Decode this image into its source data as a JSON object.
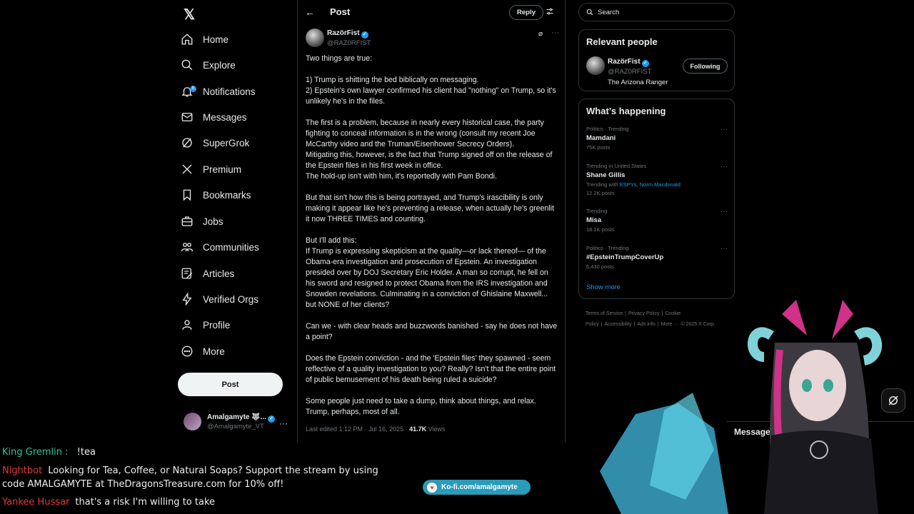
{
  "nav": {
    "items": [
      {
        "label": "Home",
        "icon": "home-icon"
      },
      {
        "label": "Explore",
        "icon": "search-icon"
      },
      {
        "label": "Notifications",
        "icon": "bell-icon",
        "badge": "6"
      },
      {
        "label": "Messages",
        "icon": "mail-icon"
      },
      {
        "label": "SuperGrok",
        "icon": "grok-icon"
      },
      {
        "label": "Premium",
        "icon": "x-logo-icon"
      },
      {
        "label": "Bookmarks",
        "icon": "bookmark-icon"
      },
      {
        "label": "Jobs",
        "icon": "briefcase-icon"
      },
      {
        "label": "Communities",
        "icon": "people-icon"
      },
      {
        "label": "Articles",
        "icon": "article-icon"
      },
      {
        "label": "Verified Orgs",
        "icon": "lightning-icon"
      },
      {
        "label": "Profile",
        "icon": "person-icon"
      },
      {
        "label": "More",
        "icon": "more-circle-icon"
      }
    ],
    "post_button": "Post",
    "account": {
      "name": "Amalgamyte 🐺...",
      "handle": "@Amalgamyte_VT"
    }
  },
  "post": {
    "header_title": "Post",
    "reply_button": "Reply",
    "author_name": "RazörFist",
    "author_handle": "@RAZ0RFIST",
    "body": [
      "Two things are true:",
      "",
      "1) Trump is shitting the bed biblically on messaging.",
      "2) Epstein's own lawyer confirmed his client had \"nothing\" on Trump, so it's unlikely he's in the files.",
      "",
      "The first is a problem, because in nearly every historical case, the party fighting to conceal information is in the wrong (consult my recent Joe McCarthy video and the Truman/Eisenhower Secrecy Orders).",
      "Mitigating this, however, is the fact that Trump signed off on the release of the Epstein files in his first week in office.",
      "The hold-up isn't with him, it's reportedly with Pam Bondi.",
      "",
      "But that isn't how this is being portrayed, and Trump's irascibility is only making it appear like he's preventing a release, when actually he's greenlit it now THREE TIMES and counting.",
      "",
      "But I'll add this:",
      "If Trump is expressing skepticism at the quality—or lack thereof— of the Obama-era investigation and prosecution of Epstein. An investigation presided over by DOJ Secretary Eric Holder. A man so corrupt, he fell on his sword and resigned to protect Obama from the IRS investigation and Snowden revelations. Culminating in a conviction of Ghislaine Maxwell... but NONE of her clients?",
      "",
      "Can we - with clear heads and buzzwords banished - say he does not have a point?",
      "",
      "Does the Epstein conviction - and the 'Epstein files' they spawned - seem reflective of a quality investigation to you? Really? Isn't that the entire point of public bemusement of his death being ruled a suicide?",
      "",
      "Some people just need to take a dump, think about things, and relax. Trump, perhaps, most of all."
    ],
    "meta_edited": "Last edited 1:12 PM · Jul 16, 2025 · ",
    "meta_views_count": "41.7K",
    "meta_views_label": " Views"
  },
  "search": {
    "placeholder": "Search"
  },
  "relevant": {
    "title": "Relevant people",
    "name": "RazörFist",
    "handle": "@RAZ0RFIST",
    "bio": "The Arizona Ranger",
    "button": "Following"
  },
  "trends": {
    "title": "What’s happening",
    "items": [
      {
        "context": "Politics · Trending",
        "title": "Mamdani",
        "sub": "75K posts"
      },
      {
        "context": "Trending in United States",
        "title": "Shane Gillis",
        "with_prefix": "Trending with ",
        "with_links": "ESPYs, Norm Macdonald",
        "sub": "12.2K posts"
      },
      {
        "context": "Trending",
        "title": "Misa",
        "sub": "18.1K posts"
      },
      {
        "context": "Politics · Trending",
        "title": "#EpsteinTrumpCoverUp",
        "sub": "6,430 posts"
      }
    ],
    "show_more": "Show more"
  },
  "footer": {
    "links": [
      "Terms of Service",
      "|",
      "Privacy Policy",
      "|",
      "Cookie Policy",
      "|",
      "Accessibility",
      "|",
      "Ads info",
      "|",
      "More ···",
      "© 2025 X Corp."
    ]
  },
  "chat": [
    {
      "user": "King Gremlin",
      "sep": " : ",
      "text": "!tea",
      "color": "teal"
    },
    {
      "user": "Nightbot",
      "text": "Looking for Tea, Coffee, or Natural Soaps? Support the stream by using"
    },
    {
      "user": "",
      "text": "code AMALGAMYTE at TheDragonsTreasure.com for 10% off!"
    },
    {
      "user": "Yankee Hussar",
      "text": "that's a risk I'm willing to take"
    }
  ],
  "kofi": {
    "label": "Ko-fi.com/amalgamyte"
  },
  "messages_drawer": {
    "label": "Messages"
  },
  "colors": {
    "accent": "#1d9bf0",
    "background": "#000000",
    "border": "#2f3336",
    "muted": "#71767b"
  }
}
